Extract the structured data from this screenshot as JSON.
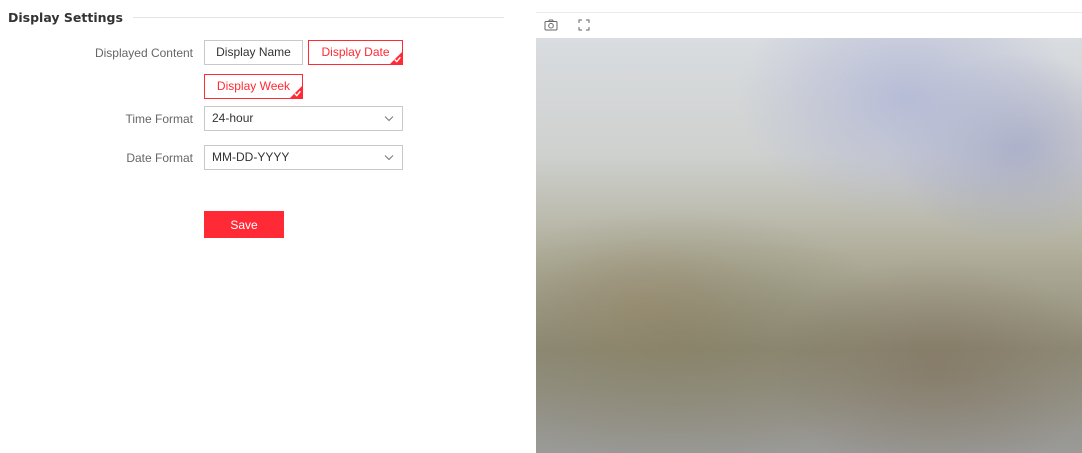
{
  "section": {
    "title": "Display Settings"
  },
  "form": {
    "displayed_content": {
      "label": "Displayed Content",
      "options": [
        {
          "label": "Display Name",
          "selected": false
        },
        {
          "label": "Display Date",
          "selected": true
        },
        {
          "label": "Display Week",
          "selected": true
        }
      ]
    },
    "time_format": {
      "label": "Time Format",
      "value": "24-hour"
    },
    "date_format": {
      "label": "Date Format",
      "value": "MM-DD-YYYY"
    },
    "save_label": "Save"
  },
  "preview": {
    "toolbar": {
      "icons": [
        "camera-icon",
        "fullscreen-icon"
      ]
    }
  },
  "colors": {
    "accent": "#ff2a35",
    "label_text": "#666666",
    "border": "#c9c9c9"
  }
}
